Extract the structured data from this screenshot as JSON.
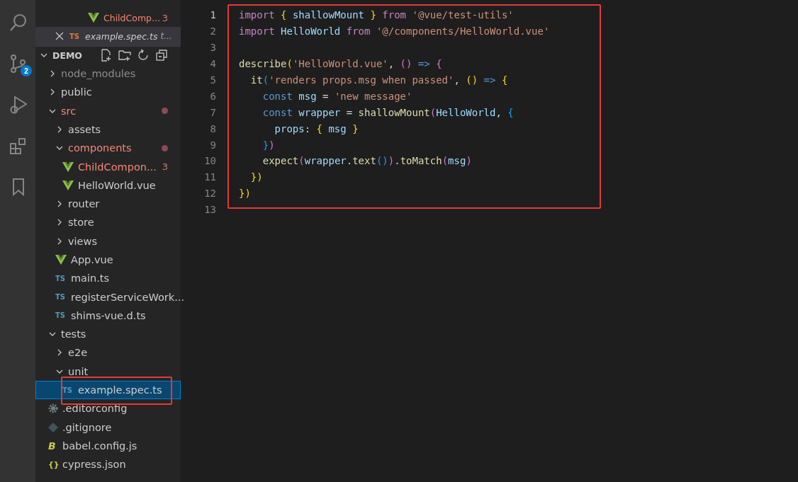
{
  "activity_bar": [
    {
      "kind": "search",
      "selected": false
    },
    {
      "kind": "source-control",
      "badge": "2",
      "selected": false
    },
    {
      "kind": "run",
      "selected": false
    },
    {
      "kind": "extensions",
      "selected": false
    },
    {
      "kind": "bookmark",
      "selected": false
    }
  ],
  "open_editors": [
    {
      "kind": "vue",
      "name": "ChildComp...",
      "badge": "3",
      "error": true,
      "italic": false,
      "selected": false
    },
    {
      "kind": "ts",
      "icon_text": "TS",
      "name": "example.spec.ts",
      "description": "t...",
      "error": false,
      "italic": true,
      "selected": true
    }
  ],
  "explorer": {
    "title": "DEMO",
    "tree": [
      {
        "name": "node_modules",
        "kind": "folder",
        "expanded": false,
        "dimmed": true,
        "error": false,
        "selected": false
      },
      {
        "name": "public",
        "kind": "folder",
        "expanded": false,
        "dimmed": false,
        "error": false,
        "selected": false
      },
      {
        "name": "src",
        "kind": "folder",
        "expanded": true,
        "dimmed": false,
        "error": true,
        "selected": false,
        "children": [
          {
            "name": "assets",
            "kind": "folder",
            "expanded": false,
            "dimmed": false,
            "error": false,
            "selected": false
          },
          {
            "name": "components",
            "kind": "folder",
            "expanded": true,
            "dimmed": false,
            "error": true,
            "selected": false,
            "children": [
              {
                "name": "ChildCompon...",
                "kind": "vue",
                "badge": "3",
                "dimmed": false,
                "error": true,
                "selected": false
              },
              {
                "name": "HelloWorld.vue",
                "kind": "vue",
                "dimmed": false,
                "error": false,
                "selected": false
              }
            ]
          },
          {
            "name": "router",
            "kind": "folder",
            "expanded": false,
            "dimmed": false,
            "error": false,
            "selected": false
          },
          {
            "name": "store",
            "kind": "folder",
            "expanded": false,
            "dimmed": false,
            "error": false,
            "selected": false
          },
          {
            "name": "views",
            "kind": "folder",
            "expanded": false,
            "dimmed": false,
            "error": false,
            "selected": false
          },
          {
            "name": "App.vue",
            "kind": "vue",
            "dimmed": false,
            "error": false,
            "selected": false
          },
          {
            "name": "main.ts",
            "kind": "ts",
            "icon_text": "TS",
            "dimmed": false,
            "error": false,
            "selected": false
          },
          {
            "name": "registerServiceWork...",
            "kind": "ts",
            "icon_text": "TS",
            "dimmed": false,
            "error": false,
            "selected": false
          },
          {
            "name": "shims-vue.d.ts",
            "kind": "ts",
            "icon_text": "TS",
            "dimmed": false,
            "error": false,
            "selected": false
          }
        ]
      },
      {
        "name": "tests",
        "kind": "folder",
        "expanded": true,
        "dimmed": false,
        "error": false,
        "selected": false,
        "children": [
          {
            "name": "e2e",
            "kind": "folder",
            "expanded": false,
            "dimmed": false,
            "error": false,
            "selected": false
          },
          {
            "name": "unit",
            "kind": "folder",
            "expanded": true,
            "dimmed": false,
            "error": false,
            "selected": false,
            "children": [
              {
                "name": "example.spec.ts",
                "kind": "ts",
                "icon_text": "TS",
                "dimmed": false,
                "error": false,
                "selected": true
              }
            ]
          }
        ]
      },
      {
        "name": ".editorconfig",
        "kind": "gear",
        "dimmed": false,
        "error": false,
        "selected": false
      },
      {
        "name": ".gitignore",
        "kind": "git",
        "dimmed": false,
        "error": false,
        "selected": false
      },
      {
        "name": "babel.config.js",
        "kind": "babel",
        "icon_text": "B",
        "dimmed": false,
        "error": false,
        "selected": false
      },
      {
        "name": "cypress.json",
        "kind": "json",
        "icon_text": "{}",
        "dimmed": false,
        "error": false,
        "selected": false
      }
    ]
  },
  "editor": {
    "lines": [
      {
        "number": "1",
        "current": true,
        "tokens": [
          {
            "t": "import ",
            "kind": "kw"
          },
          {
            "t": "{ ",
            "kind": "b1"
          },
          {
            "t": "shallowMount ",
            "kind": "var"
          },
          {
            "t": "} ",
            "kind": "b1"
          },
          {
            "t": "from ",
            "kind": "kw"
          },
          {
            "t": "'@vue/test-utils'",
            "kind": "str"
          }
        ]
      },
      {
        "number": "2",
        "current": false,
        "tokens": [
          {
            "t": "import ",
            "kind": "kw"
          },
          {
            "t": "HelloWorld ",
            "kind": "var"
          },
          {
            "t": "from ",
            "kind": "kw"
          },
          {
            "t": "'@/components/HelloWorld.vue'",
            "kind": "str"
          }
        ]
      },
      {
        "number": "3",
        "current": false
      },
      {
        "number": "4",
        "current": false,
        "tokens": [
          {
            "t": "describe",
            "kind": "fn"
          },
          {
            "t": "(",
            "kind": "b1"
          },
          {
            "t": "'HelloWorld.vue'",
            "kind": "str"
          },
          {
            "t": ", ",
            "kind": "plain"
          },
          {
            "t": "() ",
            "kind": "b2"
          },
          {
            "t": "=> ",
            "kind": "storage"
          },
          {
            "t": "{",
            "kind": "b2"
          }
        ]
      },
      {
        "number": "5",
        "current": false,
        "tokens": [
          {
            "t": "  it",
            "kind": "fn"
          },
          {
            "t": "(",
            "kind": "b3"
          },
          {
            "t": "'renders props.msg when passed'",
            "kind": "str"
          },
          {
            "t": ", ",
            "kind": "plain"
          },
          {
            "t": "() ",
            "kind": "b1"
          },
          {
            "t": "=> ",
            "kind": "storage"
          },
          {
            "t": "{",
            "kind": "b1"
          }
        ]
      },
      {
        "number": "6",
        "current": false,
        "tokens": [
          {
            "t": "    const ",
            "kind": "storage"
          },
          {
            "t": "msg ",
            "kind": "var"
          },
          {
            "t": "= ",
            "kind": "plain"
          },
          {
            "t": "'new message'",
            "kind": "str"
          }
        ]
      },
      {
        "number": "7",
        "current": false,
        "tokens": [
          {
            "t": "    const ",
            "kind": "storage"
          },
          {
            "t": "wrapper ",
            "kind": "var"
          },
          {
            "t": "= ",
            "kind": "plain"
          },
          {
            "t": "shallowMount",
            "kind": "fn"
          },
          {
            "t": "(",
            "kind": "b2"
          },
          {
            "t": "HelloWorld",
            "kind": "var"
          },
          {
            "t": ", ",
            "kind": "plain"
          },
          {
            "t": "{",
            "kind": "b3"
          }
        ]
      },
      {
        "number": "8",
        "current": false,
        "tokens": [
          {
            "t": "      props",
            "kind": "var"
          },
          {
            "t": ": ",
            "kind": "plain"
          },
          {
            "t": "{ ",
            "kind": "b1"
          },
          {
            "t": "msg ",
            "kind": "var"
          },
          {
            "t": "}",
            "kind": "b1"
          }
        ]
      },
      {
        "number": "9",
        "current": false,
        "tokens": [
          {
            "t": "    }",
            "kind": "b3"
          },
          {
            "t": ")",
            "kind": "b2"
          }
        ]
      },
      {
        "number": "10",
        "current": false,
        "tokens": [
          {
            "t": "    expect",
            "kind": "fn"
          },
          {
            "t": "(",
            "kind": "b2"
          },
          {
            "t": "wrapper",
            "kind": "var"
          },
          {
            "t": ".",
            "kind": "plain"
          },
          {
            "t": "text",
            "kind": "fn"
          },
          {
            "t": "()",
            "kind": "b3"
          },
          {
            "t": ")",
            "kind": "b2"
          },
          {
            "t": ".",
            "kind": "plain"
          },
          {
            "t": "toMatch",
            "kind": "fn"
          },
          {
            "t": "(",
            "kind": "b2"
          },
          {
            "t": "msg",
            "kind": "var"
          },
          {
            "t": ")",
            "kind": "b2"
          }
        ]
      },
      {
        "number": "11",
        "current": false,
        "tokens": [
          {
            "t": "  })",
            "kind": "b1"
          }
        ]
      },
      {
        "number": "12",
        "current": false,
        "tokens": [
          {
            "t": "})",
            "kind": "b1"
          }
        ]
      },
      {
        "number": "13",
        "current": false
      }
    ]
  }
}
